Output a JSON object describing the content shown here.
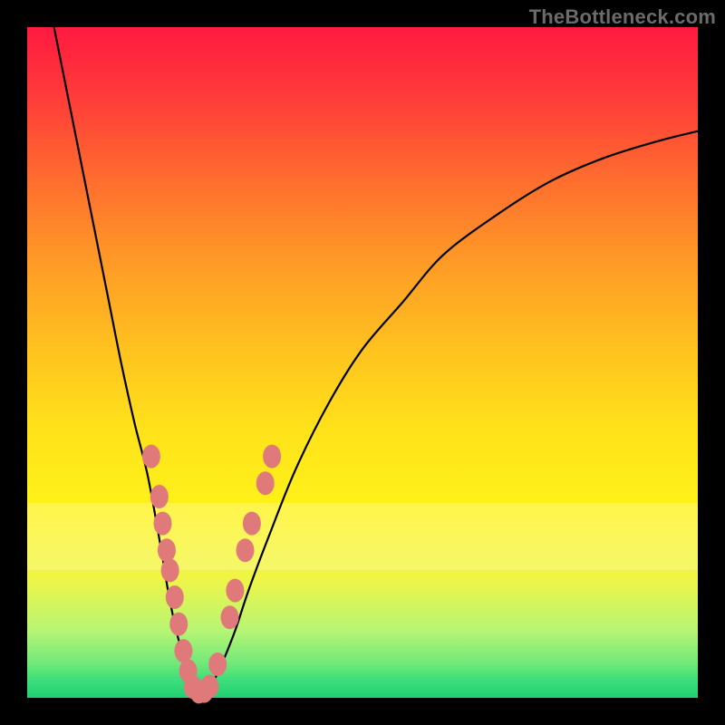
{
  "watermark": "TheBottleneck.com",
  "colors": {
    "background": "#000000",
    "gradient_top": "#ff1a40",
    "gradient_bottom": "#17d06a",
    "curve": "#000000",
    "dots": "#e07a7a"
  },
  "chart_data": {
    "type": "line",
    "title": "",
    "xlabel": "",
    "ylabel": "",
    "xlim": [
      0,
      100
    ],
    "ylim": [
      0,
      100
    ],
    "grid": false,
    "legend": false,
    "series": [
      {
        "name": "left-branch",
        "x": [
          4,
          6,
          8,
          10,
          12,
          14,
          16,
          18,
          20,
          21,
          22,
          23,
          23.7,
          24.3,
          25.0
        ],
        "y": [
          100,
          90,
          80,
          70,
          60,
          50,
          41,
          33,
          22,
          16,
          11,
          7,
          4,
          2,
          1
        ]
      },
      {
        "name": "right-branch",
        "x": [
          26.5,
          27.5,
          29,
          31,
          33,
          36,
          40,
          45,
          50,
          56,
          62,
          70,
          78,
          86,
          94,
          100
        ],
        "y": [
          1,
          2,
          5,
          10,
          16,
          24,
          34,
          44,
          52,
          59,
          66,
          72,
          77,
          80.5,
          83,
          84.5
        ]
      },
      {
        "name": "valley-floor",
        "x": [
          25.0,
          25.5,
          26.0,
          26.5
        ],
        "y": [
          1,
          0.7,
          0.7,
          1
        ]
      }
    ],
    "markers": [
      {
        "series": "left-branch",
        "x": 18.5,
        "y": 36
      },
      {
        "series": "left-branch",
        "x": 19.7,
        "y": 30
      },
      {
        "series": "left-branch",
        "x": 20.2,
        "y": 26
      },
      {
        "series": "left-branch",
        "x": 20.8,
        "y": 22
      },
      {
        "series": "left-branch",
        "x": 21.3,
        "y": 19
      },
      {
        "series": "left-branch",
        "x": 22.0,
        "y": 15
      },
      {
        "series": "left-branch",
        "x": 22.6,
        "y": 11
      },
      {
        "series": "left-branch",
        "x": 23.3,
        "y": 7
      },
      {
        "series": "left-branch",
        "x": 24.0,
        "y": 4
      },
      {
        "series": "valley-floor",
        "x": 24.7,
        "y": 1.6
      },
      {
        "series": "valley-floor",
        "x": 25.6,
        "y": 0.9
      },
      {
        "series": "valley-floor",
        "x": 26.4,
        "y": 1.0
      },
      {
        "series": "valley-floor",
        "x": 27.2,
        "y": 1.7
      },
      {
        "series": "right-branch",
        "x": 28.4,
        "y": 5
      },
      {
        "series": "right-branch",
        "x": 30.2,
        "y": 12
      },
      {
        "series": "right-branch",
        "x": 31.0,
        "y": 16
      },
      {
        "series": "right-branch",
        "x": 32.5,
        "y": 22
      },
      {
        "series": "right-branch",
        "x": 33.5,
        "y": 26
      },
      {
        "series": "right-branch",
        "x": 35.5,
        "y": 32
      },
      {
        "series": "right-branch",
        "x": 36.5,
        "y": 36
      }
    ]
  }
}
